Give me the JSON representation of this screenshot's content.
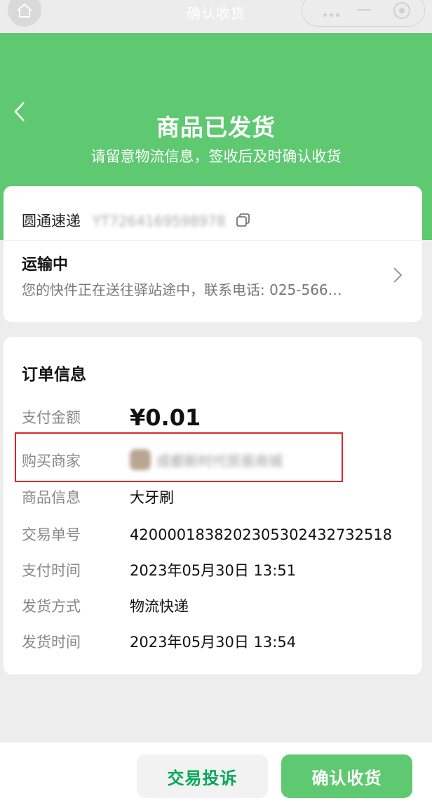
{
  "window": {
    "title": "确认收货"
  },
  "header": {
    "title": "商品已发货",
    "subtitle": "请留意物流信息，签收后及时确认收货"
  },
  "shipping": {
    "carrier": "圆通速递",
    "tracking_number": "YT7264169598978",
    "status_title": "运输中",
    "status_desc": "您的快件正在送往驿站途中，联系电话: 025-566…"
  },
  "order": {
    "section_title": "订单信息",
    "rows": {
      "amount": {
        "label": "支付金额",
        "value": "¥0.01"
      },
      "merchant": {
        "label": "购买商家",
        "value": "成都新时代贸易商城"
      },
      "goods": {
        "label": "商品信息",
        "value": "大牙刷"
      },
      "txn": {
        "label": "交易单号",
        "value": "4200001838202305302432732518"
      },
      "pay_time": {
        "label": "支付时间",
        "value": "2023年05月30日 13:51"
      },
      "ship_method": {
        "label": "发货方式",
        "value": "物流快递"
      },
      "ship_time": {
        "label": "发货时间",
        "value": "2023年05月30日 13:54"
      }
    }
  },
  "footer": {
    "complain_label": "交易投诉",
    "confirm_label": "确认收货"
  },
  "colors": {
    "brand_green": "#5ec971",
    "complain_text": "#07a85a",
    "highlight_red": "#d9252b"
  },
  "icons": [
    "home-icon",
    "more-dots-icon",
    "minimize-icon",
    "close-target-icon",
    "back-chevron-icon",
    "copy-icon",
    "chevron-right-icon"
  ]
}
